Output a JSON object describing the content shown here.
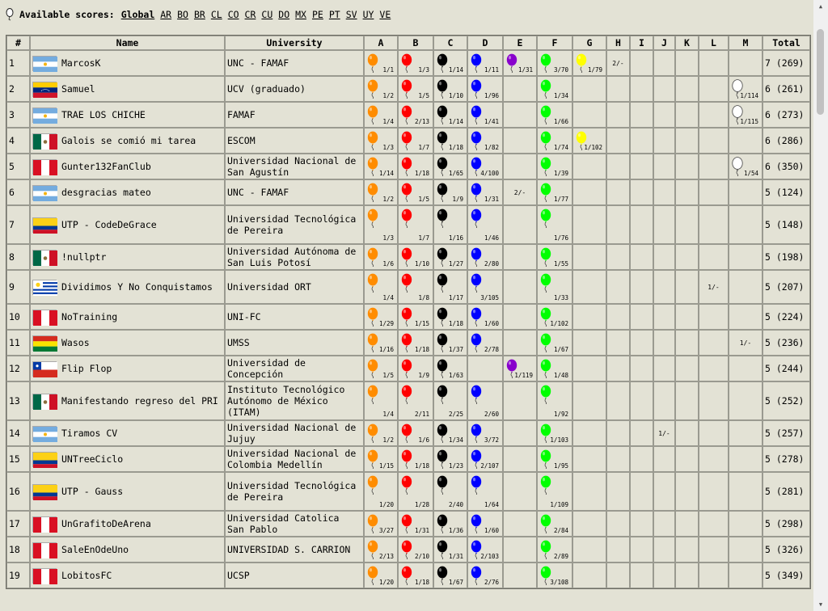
{
  "header": {
    "label": "Available scores:",
    "scores": [
      "Global",
      "AR",
      "BO",
      "BR",
      "CL",
      "CO",
      "CR",
      "CU",
      "DO",
      "MX",
      "PE",
      "PT",
      "SV",
      "UY",
      "VE"
    ],
    "active": "Global"
  },
  "table": {
    "columns": {
      "rank": "#",
      "name": "Name",
      "university": "University",
      "problems": [
        "A",
        "B",
        "C",
        "D",
        "E",
        "F",
        "G",
        "H",
        "I",
        "J",
        "K",
        "L",
        "M"
      ],
      "total": "Total"
    },
    "colors": {
      "A": "#ff8c00",
      "B": "#ff0000",
      "C": "#000000",
      "D": "#0000ff",
      "E": "#8800cc",
      "F": "#00ff00",
      "G": "#ffff00",
      "H": "#ffffff",
      "I": "#ffffff",
      "J": "#ffffff",
      "K": "#ffffff",
      "L": "#ffffff",
      "M": "#ffffff"
    },
    "rows": [
      {
        "rank": "1",
        "country": "AR",
        "name": "MarcosK",
        "university": "UNC - FAMAF",
        "total": "7 (269)",
        "scores": {
          "A": "1/1",
          "B": "1/3",
          "C": "1/14",
          "D": "1/11",
          "E": "1/31",
          "F": "3/70",
          "G": "1/79",
          "H": "2/-"
        }
      },
      {
        "rank": "2",
        "country": "VE",
        "name": "Samuel",
        "university": "UCV (graduado)",
        "total": "6 (261)",
        "scores": {
          "A": "1/2",
          "B": "1/5",
          "C": "1/10",
          "D": "1/96",
          "F": "1/34",
          "M": "1/114"
        }
      },
      {
        "rank": "3",
        "country": "AR",
        "name": "TRAE LOS CHICHE",
        "university": "FAMAF",
        "total": "6 (273)",
        "scores": {
          "A": "1/4",
          "B": "2/13",
          "C": "1/14",
          "D": "1/41",
          "F": "1/66",
          "M": "1/115"
        }
      },
      {
        "rank": "4",
        "country": "MX",
        "name": "Galois se comió mi tarea",
        "university": "ESCOM",
        "total": "6 (286)",
        "scores": {
          "A": "1/3",
          "B": "1/7",
          "C": "1/18",
          "D": "1/82",
          "F": "1/74",
          "G": "1/102"
        }
      },
      {
        "rank": "5",
        "country": "PE",
        "name": "Gunter132FanClub",
        "university": "Universidad Nacional de San Agustín",
        "total": "6 (350)",
        "scores": {
          "A": "1/14",
          "B": "1/18",
          "C": "1/65",
          "D": "4/100",
          "F": "1/39",
          "M": "1/54"
        }
      },
      {
        "rank": "6",
        "country": "AR",
        "name": "desgracias mateo",
        "university": "UNC - FAMAF",
        "total": "5 (124)",
        "scores": {
          "A": "1/2",
          "B": "1/5",
          "C": "1/9",
          "D": "1/31",
          "E": "2/-",
          "F": "1/77"
        }
      },
      {
        "rank": "7",
        "country": "CO",
        "name": "UTP - CodeDeGrace",
        "university": "Universidad Tecnológica de Pereira",
        "total": "5 (148)",
        "scores": {
          "A": "1/3",
          "B": "1/7",
          "C": "1/16",
          "D": "1/46",
          "F": "1/76"
        }
      },
      {
        "rank": "8",
        "country": "MX",
        "name": "!nullptr",
        "university": "Universidad Autónoma de San Luis Potosí",
        "total": "5 (198)",
        "scores": {
          "A": "1/6",
          "B": "1/10",
          "C": "1/27",
          "D": "2/80",
          "F": "1/55"
        }
      },
      {
        "rank": "9",
        "country": "UY",
        "name": "Dividimos Y No Conquistamos",
        "university": "Universidad ORT",
        "total": "5 (207)",
        "scores": {
          "A": "1/4",
          "B": "1/8",
          "C": "1/17",
          "D": "3/105",
          "F": "1/33",
          "L": "1/-"
        }
      },
      {
        "rank": "10",
        "country": "PE",
        "name": "NoTraining",
        "university": "UNI-FC",
        "total": "5 (224)",
        "scores": {
          "A": "1/29",
          "B": "1/15",
          "C": "1/18",
          "D": "1/60",
          "F": "1/102"
        }
      },
      {
        "rank": "11",
        "country": "BO",
        "name": "Wasos",
        "university": "UMSS",
        "total": "5 (236)",
        "scores": {
          "A": "1/16",
          "B": "1/18",
          "C": "1/37",
          "D": "2/78",
          "F": "1/67",
          "M": "1/-"
        }
      },
      {
        "rank": "12",
        "country": "CL",
        "name": "Flip Flop",
        "university": "Universidad de Concepción",
        "total": "5 (244)",
        "scores": {
          "A": "1/5",
          "B": "1/9",
          "C": "1/63",
          "E": "1/119",
          "F": "1/48"
        }
      },
      {
        "rank": "13",
        "country": "MX",
        "name": "Manifestando regreso del PRI",
        "university": "Instituto Tecnológico Autónomo de México (ITAM)",
        "total": "5 (252)",
        "scores": {
          "A": "1/4",
          "B": "2/11",
          "C": "2/25",
          "D": "2/60",
          "F": "1/92"
        }
      },
      {
        "rank": "14",
        "country": "AR",
        "name": "Tiramos CV",
        "university": "Universidad Nacional de Jujuy",
        "total": "5 (257)",
        "scores": {
          "A": "1/2",
          "B": "1/6",
          "C": "1/34",
          "D": "3/72",
          "F": "1/103",
          "J": "1/-"
        }
      },
      {
        "rank": "15",
        "country": "CO",
        "name": "UNTreeCiclo",
        "university": "Universidad Nacional de Colombia Medellín",
        "total": "5 (278)",
        "scores": {
          "A": "1/15",
          "B": "1/18",
          "C": "1/23",
          "D": "2/107",
          "F": "1/95"
        }
      },
      {
        "rank": "16",
        "country": "CO",
        "name": "UTP - Gauss",
        "university": "Universidad Tecnológica de Pereira",
        "total": "5 (281)",
        "scores": {
          "A": "1/20",
          "B": "1/28",
          "C": "2/40",
          "D": "1/64",
          "F": "1/109"
        }
      },
      {
        "rank": "17",
        "country": "PE",
        "name": "UnGrafitoDeArena",
        "university": "Universidad Catolica San Pablo",
        "total": "5 (298)",
        "scores": {
          "A": "3/27",
          "B": "1/31",
          "C": "1/36",
          "D": "1/60",
          "F": "2/84"
        }
      },
      {
        "rank": "18",
        "country": "PE",
        "name": "SaleEnOdeUno",
        "university": "UNIVERSIDAD S. CARRION",
        "total": "5 (326)",
        "scores": {
          "A": "2/13",
          "B": "2/10",
          "C": "1/31",
          "D": "2/103",
          "F": "2/89"
        }
      },
      {
        "rank": "19",
        "country": "PE",
        "name": "LobitosFC",
        "university": "UCSP",
        "total": "5 (349)",
        "scores": {
          "A": "1/20",
          "B": "1/18",
          "C": "1/67",
          "D": "2/76",
          "F": "3/108"
        }
      }
    ]
  }
}
